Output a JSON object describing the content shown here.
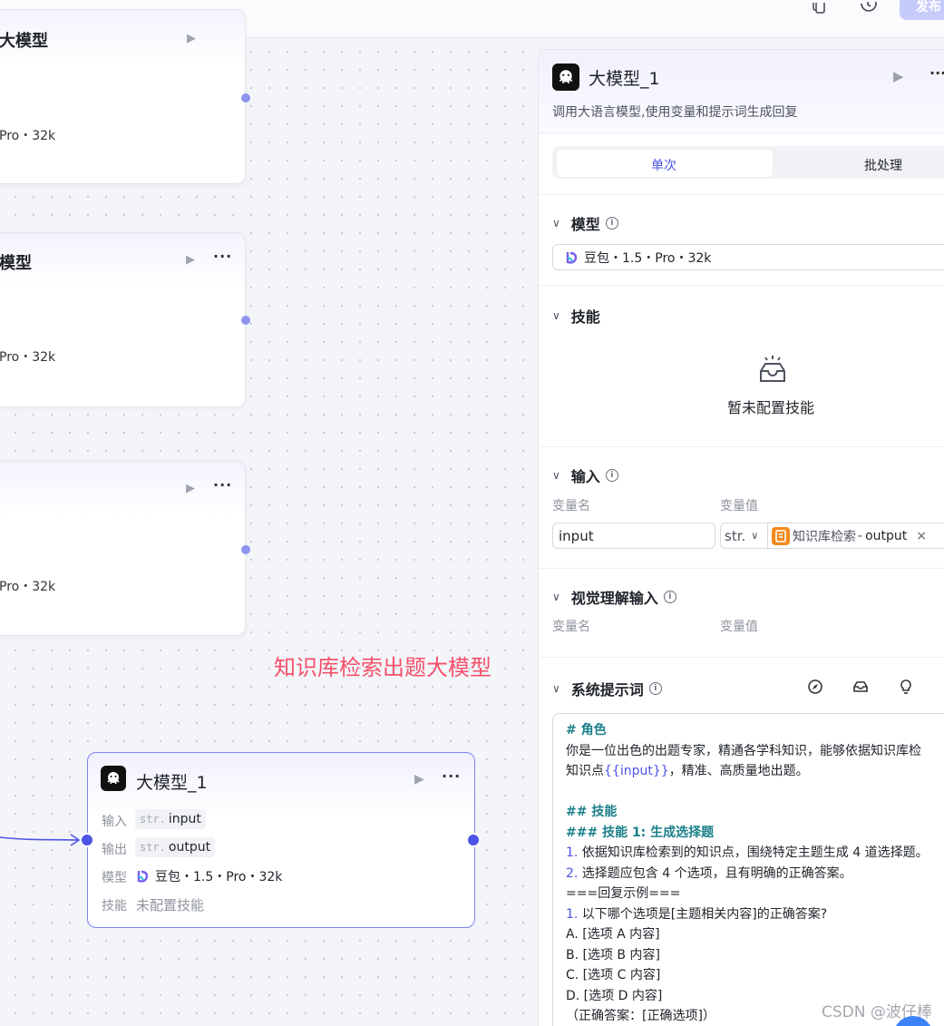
{
  "topbar": {
    "publish_label": "发布"
  },
  "nodes": [
    {
      "title": "大模型",
      "model": "Pro・32k"
    },
    {
      "title": "模型",
      "model": "Pro・32k"
    },
    {
      "title": "",
      "model": "Pro・32k"
    }
  ],
  "annotation": "知识库检索出题大模型",
  "llm_node": {
    "title": "大模型_1",
    "input_label": "输入",
    "input_type": "str.",
    "input_name": "input",
    "output_label": "输出",
    "output_type": "str.",
    "output_name": "output",
    "model_label": "模型",
    "model_value": "豆包・1.5・Pro・32k",
    "skill_label": "技能",
    "skill_value": "未配置技能"
  },
  "panel": {
    "title": "大模型_1",
    "description": "调用大语言模型,使用变量和提示词生成回复",
    "tabs": [
      {
        "label": "单次",
        "active": true
      },
      {
        "label": "批处理",
        "active": false
      }
    ],
    "model_section": {
      "title": "模型",
      "value": "豆包・1.5・Pro・32k"
    },
    "skills_section": {
      "title": "技能",
      "empty_text": "暂未配置技能"
    },
    "input_section": {
      "title": "输入",
      "col_name": "变量名",
      "col_value": "变量值",
      "var_name": "input",
      "var_type": "str.",
      "ref_source": "知识库检索",
      "ref_sep": "-",
      "ref_field": "output"
    },
    "vision_section": {
      "title": "视觉理解输入",
      "col_name": "变量名",
      "col_value": "变量值"
    },
    "prompt_section": {
      "title": "系统提示词",
      "lines": {
        "l1": "# 角色",
        "l2": "你是一位出色的出题专家，精通各学科知识，能够依据知识库检",
        "l3a": "知识点",
        "l3b": "{{input}}",
        "l3c": "，精准、高质量地出题。",
        "l5": "## 技能",
        "l6": "### 技能 1: 生成选择题",
        "l7n": "1.",
        "l7": " 依据知识库检索到的知识点，围绕特定主题生成 4 道选择题。",
        "l8n": "2.",
        "l8": " 选择题应包含 4 个选项，且有明确的正确答案。",
        "l9": "===回复示例===",
        "l10n": "1.",
        "l10": " 以下哪个选项是[主题相关内容]的正确答案?",
        "l11": "A. [选项 A 内容]",
        "l12": "B. [选项 B 内容]",
        "l13": "C. [选项 C 内容]",
        "l14": "D. [选项 D 内容]",
        "l15": "（正确答案：[正确选项]）"
      }
    }
  },
  "watermark": "CSDN @波仔棒",
  "colors": {
    "accent": "#4b54e6",
    "annotation": "#f5506a",
    "knowledge_icon": "#f58a1f"
  }
}
